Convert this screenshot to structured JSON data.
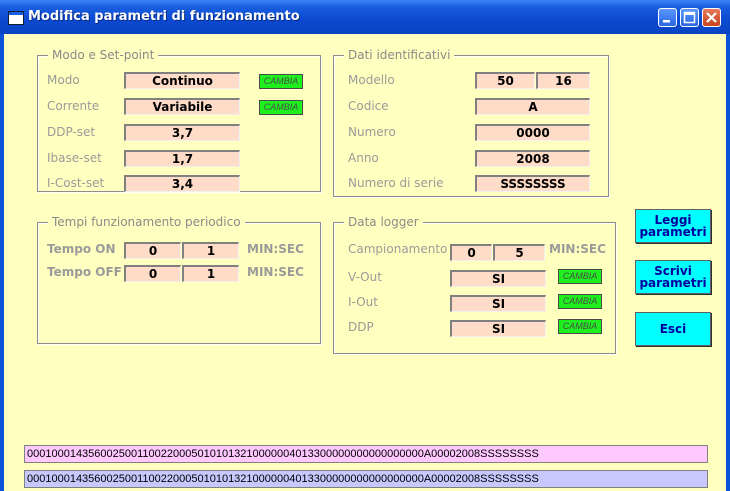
{
  "window": {
    "title": "Modifica parametri di funzionamento"
  },
  "modo_setpoint": {
    "title": "Modo e Set-point",
    "rows": [
      {
        "label": "Modo",
        "value": "Continuo",
        "action": "CAMBIA"
      },
      {
        "label": "Corrente",
        "value": "Variabile",
        "action": "CAMBIA"
      },
      {
        "label": "DDP-set",
        "value": "3,7"
      },
      {
        "label": "Ibase-set",
        "value": "1,7"
      },
      {
        "label": "I-Cost-set",
        "value": "3,4"
      }
    ]
  },
  "dati_identificativi": {
    "title": "Dati identificativi",
    "modello_label": "Modello",
    "modello_a": "50",
    "modello_b": "16",
    "codice_label": "Codice",
    "codice": "A",
    "numero_label": "Numero",
    "numero": "0000",
    "anno_label": "Anno",
    "anno": "2008",
    "serie_label": "Numero di serie",
    "serie": "SSSSSSSS"
  },
  "tempi": {
    "title": "Tempi funzionamento periodico",
    "on_label": "Tempo ON",
    "on_min": "0",
    "on_sec": "1",
    "off_label": "Tempo OFF",
    "off_min": "0",
    "off_sec": "1",
    "unit": "MIN:SEC"
  },
  "datalogger": {
    "title": "Data logger",
    "camp_label": "Campionamento",
    "camp_min": "0",
    "camp_sec": "5",
    "unit": "MIN:SEC",
    "rows": [
      {
        "label": "V-Out",
        "value": "SI",
        "action": "CAMBIA"
      },
      {
        "label": "I-Out",
        "value": "SI",
        "action": "CAMBIA"
      },
      {
        "label": "DDP",
        "value": "SI",
        "action": "CAMBIA"
      }
    ]
  },
  "buttons": {
    "leggi_l1": "Leggi",
    "leggi_l2": "parametri",
    "scrivi_l1": "Scrivi",
    "scrivi_l2": "parametri",
    "esci": "Esci"
  },
  "strings": {
    "line1": "00010001435600250011002200050101013210000004013300000000000000000A00002008SSSSSSSS",
    "line2": "00010001435600250011002200050101013210000004013300000000000000000A00002008SSSSSSSS",
    "line1_color": "#ffc8ff",
    "line2_color": "#c8c8ff"
  },
  "colors": {
    "accent_green": "#1ef01e",
    "button_cyan": "#00ffff",
    "field_bg": "#ffdcc8",
    "client_bg": "#ffffc0"
  }
}
